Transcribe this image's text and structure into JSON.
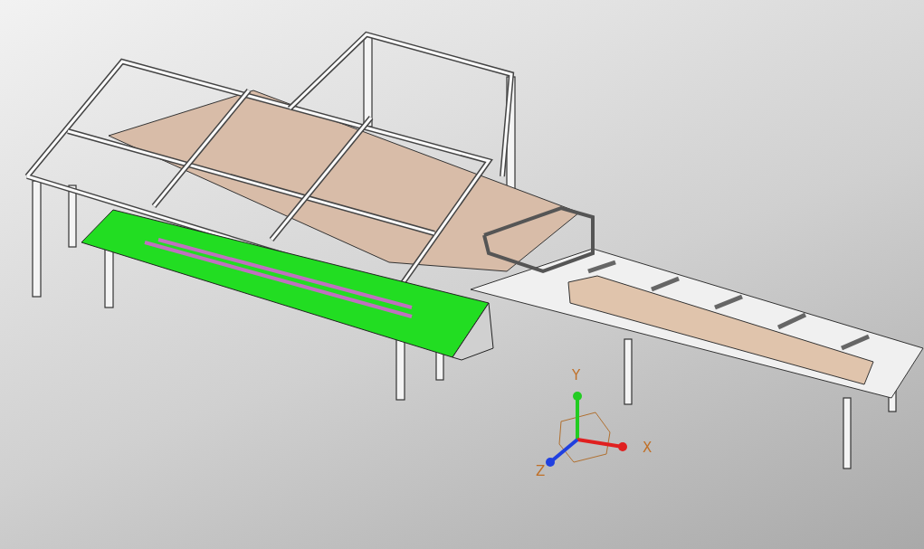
{
  "viewport": {
    "triad": {
      "axes": [
        {
          "label": "Y",
          "color": "#22cc22"
        },
        {
          "label": "X",
          "color": "#e02020"
        },
        {
          "label": "Z",
          "color": "#2040e0"
        }
      ]
    }
  }
}
